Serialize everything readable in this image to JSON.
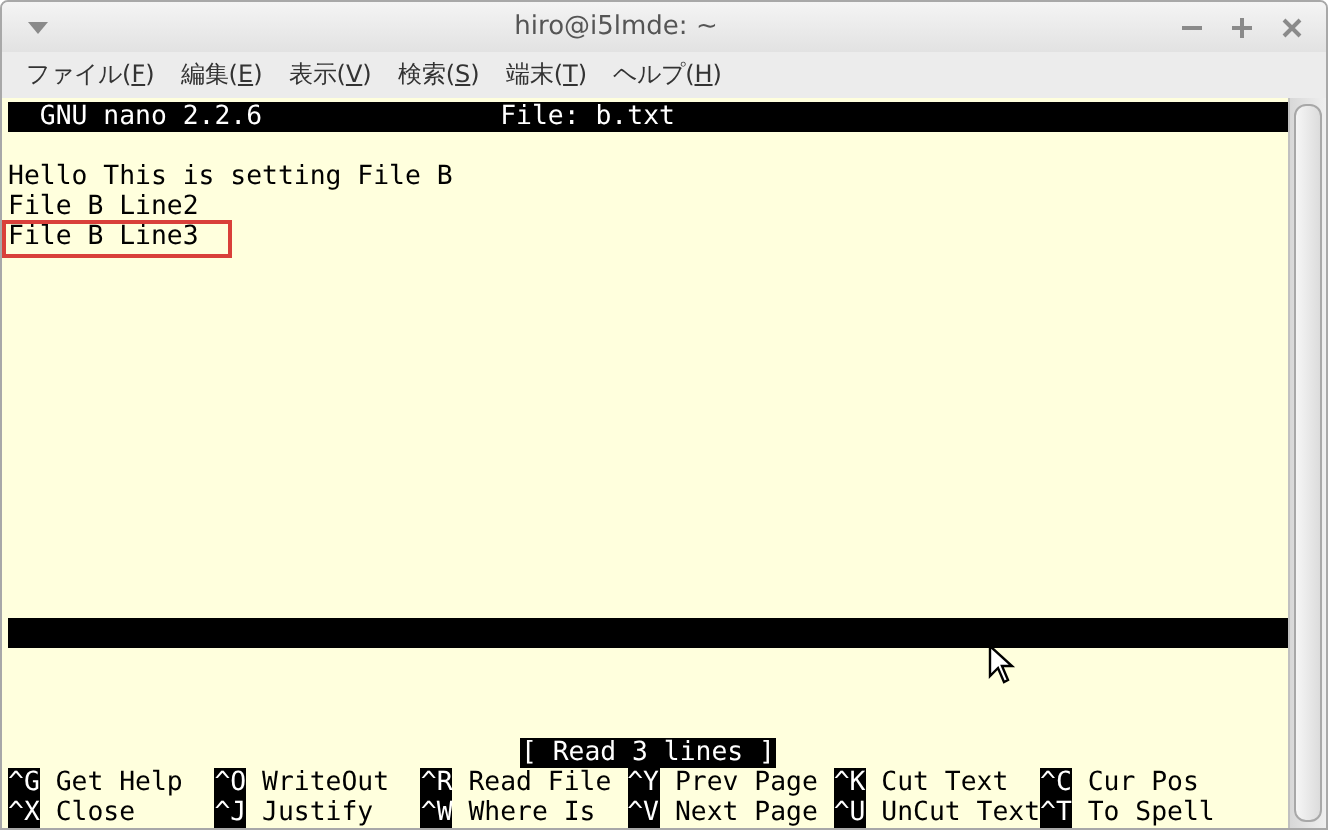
{
  "window": {
    "title": "hiro@i5lmde: ~"
  },
  "menu": [
    {
      "before": "ファイル(",
      "mnemonic": "F",
      "after": ")"
    },
    {
      "before": "編集(",
      "mnemonic": "E",
      "after": ")"
    },
    {
      "before": "表示(",
      "mnemonic": "V",
      "after": ")"
    },
    {
      "before": "検索(",
      "mnemonic": "S",
      "after": ")"
    },
    {
      "before": "端末(",
      "mnemonic": "T",
      "after": ")"
    },
    {
      "before": "ヘルプ(",
      "mnemonic": "H",
      "after": ")"
    }
  ],
  "nano": {
    "version": "GNU nano 2.2.6",
    "file": "File: b.txt",
    "lines": [
      {
        "text": "Hello This is setting File B",
        "highlighted": false
      },
      {
        "text": "File B Line2",
        "highlighted": false
      },
      {
        "text": "File B Line3",
        "highlighted": true
      }
    ],
    "status": "[ Read 3 lines ]",
    "shortcuts": [
      [
        {
          "key": "^G",
          "label": "Get Help"
        },
        {
          "key": "^O",
          "label": "WriteOut"
        },
        {
          "key": "^R",
          "label": "Read File"
        },
        {
          "key": "^Y",
          "label": "Prev Page"
        },
        {
          "key": "^K",
          "label": "Cut Text"
        },
        {
          "key": "^C",
          "label": "Cur Pos"
        }
      ],
      [
        {
          "key": "^X",
          "label": "Close"
        },
        {
          "key": "^J",
          "label": "Justify"
        },
        {
          "key": "^W",
          "label": "Where Is"
        },
        {
          "key": "^V",
          "label": "Next Page"
        },
        {
          "key": "^U",
          "label": "UnCut Text"
        },
        {
          "key": "^T",
          "label": "To Spell"
        }
      ]
    ]
  }
}
